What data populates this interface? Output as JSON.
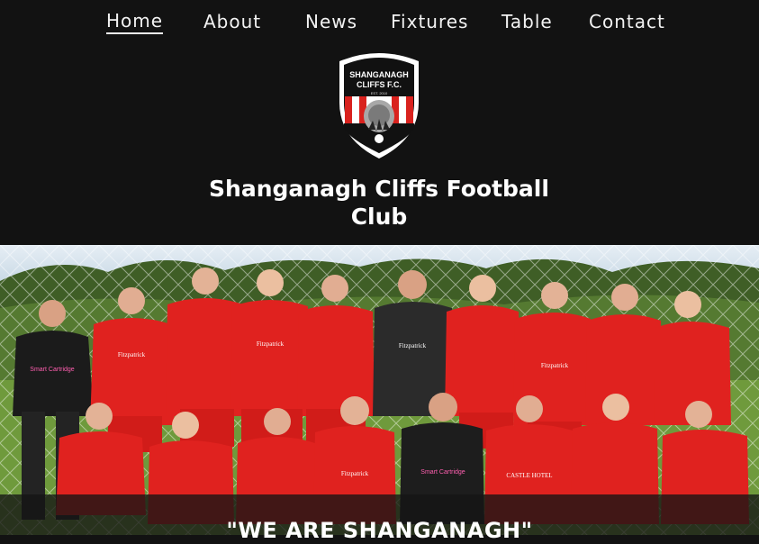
{
  "nav": {
    "items": [
      {
        "label": "Home",
        "active": true
      },
      {
        "label": "About",
        "active": false
      },
      {
        "label": "News",
        "active": false
      },
      {
        "label": "Fixtures",
        "active": false
      },
      {
        "label": "Table",
        "active": false
      },
      {
        "label": "Contact",
        "active": false
      }
    ]
  },
  "crest": {
    "name_line1": "SHANGANAGH",
    "name_line2": "CLIFFS F.C.",
    "est": "EST. 2010"
  },
  "site": {
    "title_line1": "Shanganagh Cliffs Football",
    "title_line2": "Club"
  },
  "hero": {
    "banner_text": "\"WE ARE SHANGANAGH\"",
    "sponsor": "Fitzpatrick",
    "sponsor_sub": "CASTLE HOTEL",
    "sponsor_gk": "Smart Cartridge",
    "kit_color": "#e0221f",
    "gk_color": "#2b2b2b"
  },
  "colors": {
    "background": "#121212",
    "text": "#f2f2f2",
    "sky": "#cfe0ec",
    "grass": "#6f9a3c",
    "trees": "#3d5a25"
  }
}
